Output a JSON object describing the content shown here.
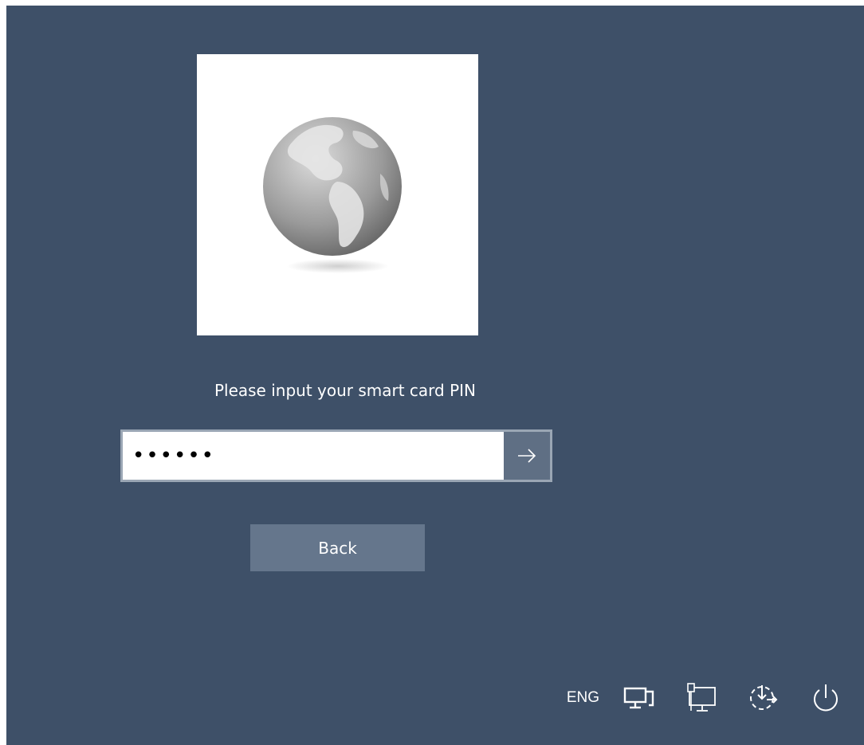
{
  "login": {
    "prompt": "Please input your smart card PIN",
    "pin_value": "••••••",
    "back_label": "Back"
  },
  "tray": {
    "language": "ENG",
    "icons": [
      "network-icon",
      "remote-desktop-icon",
      "ease-of-access-icon",
      "power-icon"
    ]
  },
  "colors": {
    "background": "#3e5068",
    "submit_button": "#5f6f84",
    "back_button": "#65768c"
  }
}
